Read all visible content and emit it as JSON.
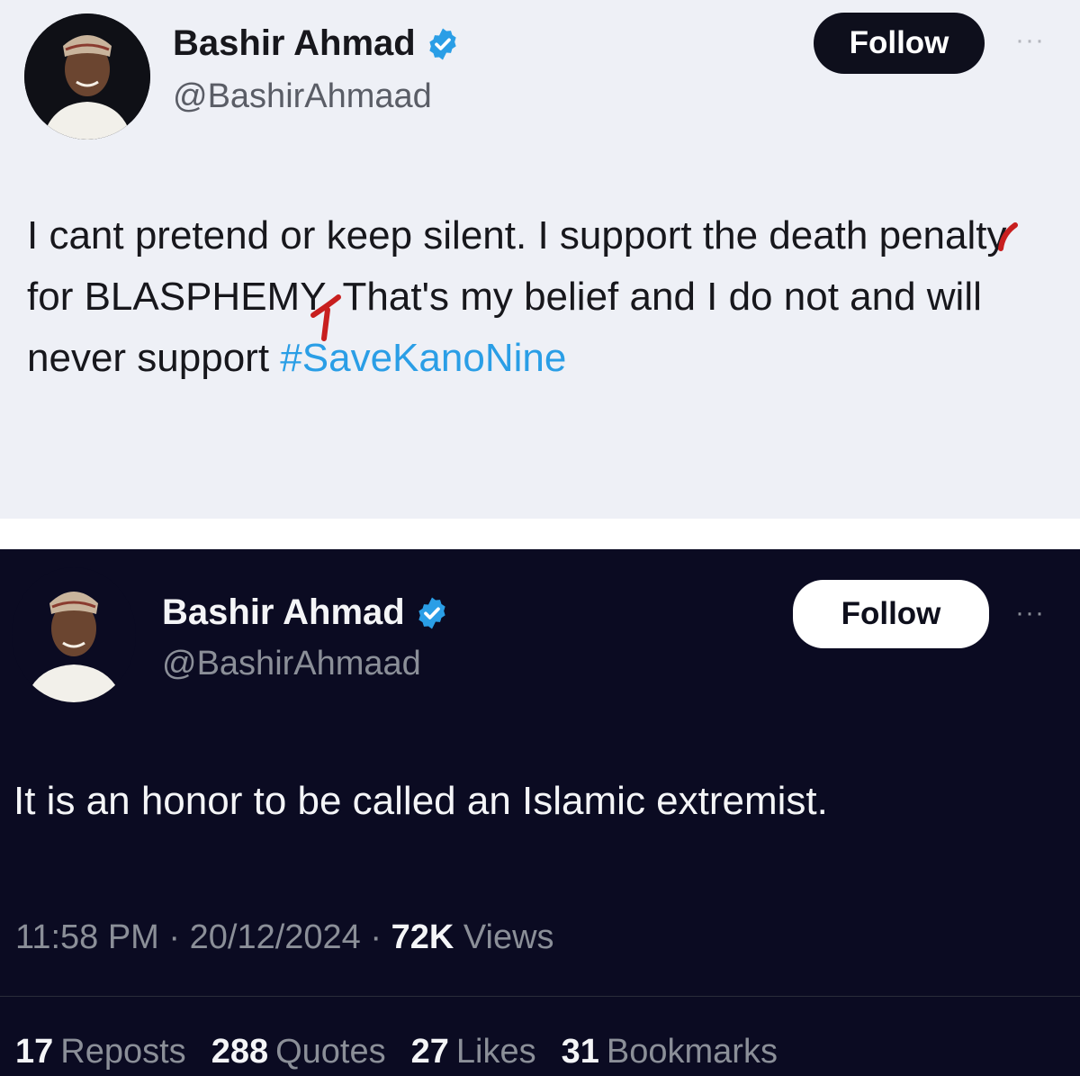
{
  "tweet_light": {
    "author": {
      "name": "Bashir Ahmad",
      "handle": "@BashirAhmaad",
      "verified": true
    },
    "follow_label": "Follow",
    "more_icon": "more-horizontal-icon",
    "text": "I cant pretend or keep silent. I support the death penalty for BLASPHEMY. That's my belief and I do not and will never support",
    "hashtag": "#SaveKanoNine",
    "theme": {
      "background": "#eef0f6",
      "text": "#17171c",
      "link": "#2a9ee6"
    }
  },
  "tweet_dark": {
    "author": {
      "name": "Bashir Ahmad",
      "handle": "@BashirAhmaad",
      "verified": true
    },
    "follow_label": "Follow",
    "more_icon": "more-horizontal-icon",
    "text": "It is an honor to be called an Islamic extremist.",
    "time": "11:58 PM",
    "date": "20/12/2024",
    "views_count": "72K",
    "views_label": "Views",
    "stats": [
      {
        "count": "17",
        "label": "Reposts"
      },
      {
        "count": "288",
        "label": "Quotes"
      },
      {
        "count": "27",
        "label": "Likes"
      },
      {
        "count": "31",
        "label": "Bookmarks"
      }
    ],
    "theme": {
      "background": "#0b0b22",
      "text": "#f4f5f7",
      "muted": "#8b8f98"
    }
  }
}
